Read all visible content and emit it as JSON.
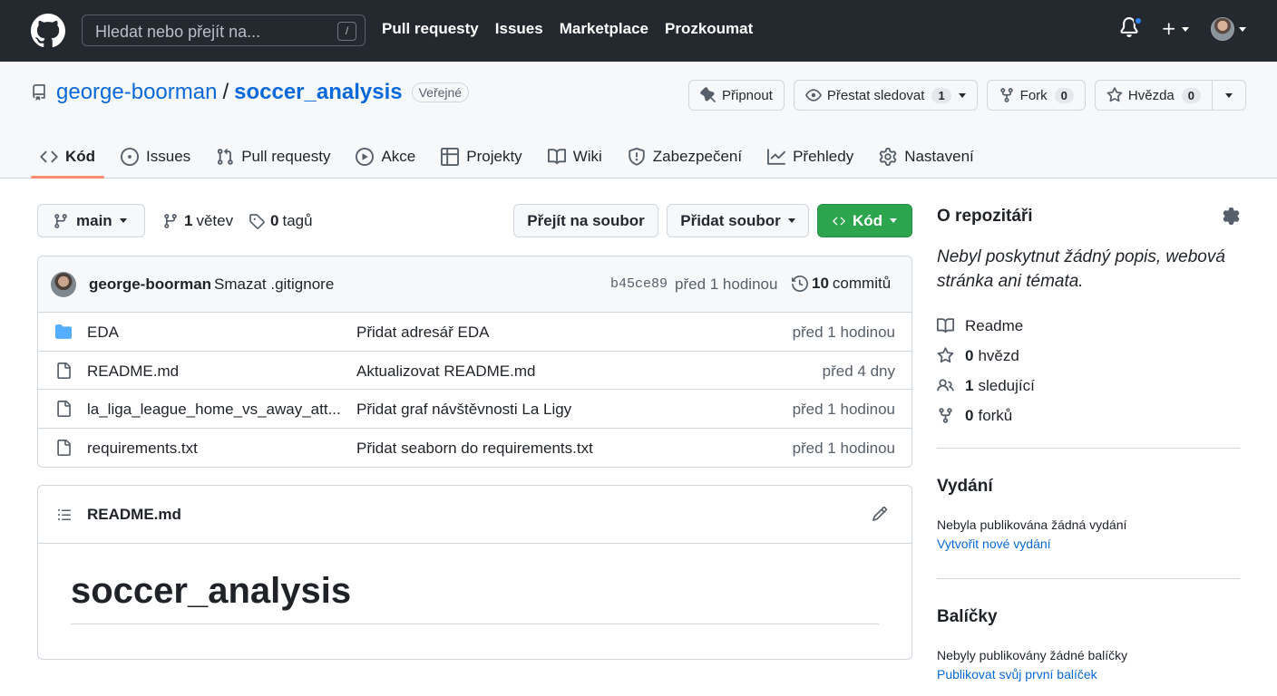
{
  "header": {
    "search_placeholder": "Hledat nebo přejít na...",
    "search_shortcut": "/",
    "nav": [
      "Pull requesty",
      "Issues",
      "Marketplace",
      "Prozkoumat"
    ]
  },
  "repo": {
    "owner": "george-boorman",
    "separator": "/",
    "name": "soccer_analysis",
    "visibility": "Veřejné",
    "pin_label": "Připnout",
    "watch_label": "Přestat sledovat",
    "watch_count": "1",
    "fork_label": "Fork",
    "fork_count": "0",
    "star_label": "Hvězda",
    "star_count": "0"
  },
  "tabs": [
    {
      "label": "Kód",
      "icon": "code-icon"
    },
    {
      "label": "Issues",
      "icon": "issue-icon"
    },
    {
      "label": "Pull requesty",
      "icon": "pull-request-icon"
    },
    {
      "label": "Akce",
      "icon": "play-icon"
    },
    {
      "label": "Projekty",
      "icon": "table-icon"
    },
    {
      "label": "Wiki",
      "icon": "book-icon"
    },
    {
      "label": "Zabezpečení",
      "icon": "shield-icon"
    },
    {
      "label": "Přehledy",
      "icon": "graph-icon"
    },
    {
      "label": "Nastavení",
      "icon": "gear-icon"
    }
  ],
  "branch": {
    "name": "main",
    "branch_count": "1",
    "branch_label": "větev",
    "tag_count": "0",
    "tag_label": "tagů",
    "goto_file": "Přejít na soubor",
    "add_file": "Přidat soubor",
    "code_button": "Kód"
  },
  "commit": {
    "author": "george-boorman",
    "message": "Smazat .gitignore",
    "hash": "b45ce89",
    "time": "před 1 hodinou",
    "count": "10",
    "count_label": "commitů"
  },
  "files": [
    {
      "name": "EDA",
      "type": "folder",
      "message": "Přidat adresář EDA",
      "time": "před 1 hodinou"
    },
    {
      "name": "README.md",
      "type": "file",
      "message": "Aktualizovat README.md",
      "time": "před 4 dny"
    },
    {
      "name": "la_liga_league_home_vs_away_att...",
      "type": "file",
      "message": "Přidat graf návštěvnosti La Ligy",
      "time": "před 1 hodinou"
    },
    {
      "name": "requirements.txt",
      "type": "file",
      "message": "Přidat seaborn do requirements.txt",
      "time": "před 1 hodinou"
    }
  ],
  "readme": {
    "file": "README.md",
    "heading": "soccer_analysis"
  },
  "sidebar": {
    "about_title": "O repozitáři",
    "about_desc": "Nebyl poskytnut žádný popis, webová stránka ani témata.",
    "readme": "Readme",
    "stars_count": "0",
    "stars_label": "hvězd",
    "watchers_count": "1",
    "watchers_label": "sledující",
    "forks_count": "0",
    "forks_label": "forků",
    "releases_title": "Vydání",
    "releases_text": "Nebyla publikována žádná vydání",
    "releases_link": "Vytvořit nové vydání",
    "packages_title": "Balíčky",
    "packages_text": "Nebyly publikovány žádné balíčky",
    "packages_link": "Publikovat svůj první balíček"
  },
  "colors": {
    "header_bg": "#24292f",
    "link": "#0969da",
    "code_button": "#2da44e",
    "active_tab_underline": "#fd8c73",
    "notification_dot": "#2f81f7"
  }
}
